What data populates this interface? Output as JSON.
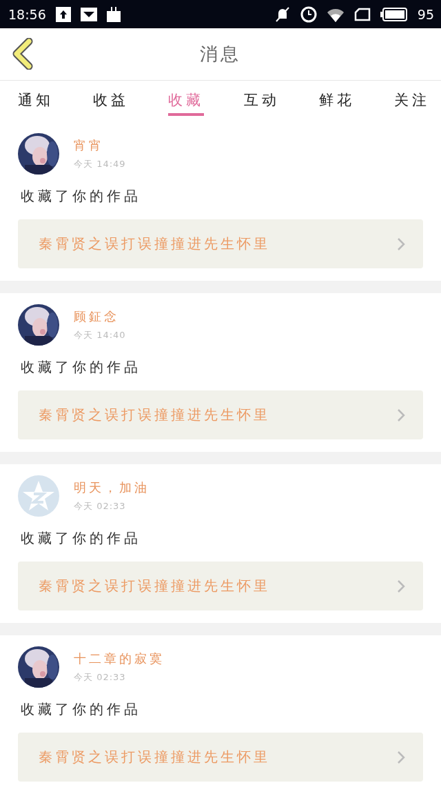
{
  "status_bar": {
    "time": "18:56",
    "battery": "95"
  },
  "header": {
    "title": "消息"
  },
  "tabs": [
    {
      "label": "通知",
      "selected": false
    },
    {
      "label": "收益",
      "selected": false
    },
    {
      "label": "收藏",
      "selected": true
    },
    {
      "label": "互动",
      "selected": false
    },
    {
      "label": "鲜花",
      "selected": false
    },
    {
      "label": "关注",
      "selected": false
    }
  ],
  "messages": [
    {
      "user": "宵宵",
      "time": "今天 14:49",
      "action": "收藏了你的作品",
      "work": "秦霄贤之误打误撞撞进先生怀里"
    },
    {
      "user": "顾鉦念",
      "time": "今天 14:40",
      "action": "收藏了你的作品",
      "work": "秦霄贤之误打误撞撞进先生怀里"
    },
    {
      "user": "明天，加油",
      "time": "今天 02:33",
      "avatar": {
        "kind": "default"
      },
      "action": "收藏了你的作品",
      "work": "秦霄贤之误打误撞撞进先生怀里"
    },
    {
      "user": "十二章的寂寞",
      "time": "今天 02:33",
      "action": "收藏了你的作品",
      "work": "秦霄贤之误打误撞撞进先生怀里"
    }
  ]
}
